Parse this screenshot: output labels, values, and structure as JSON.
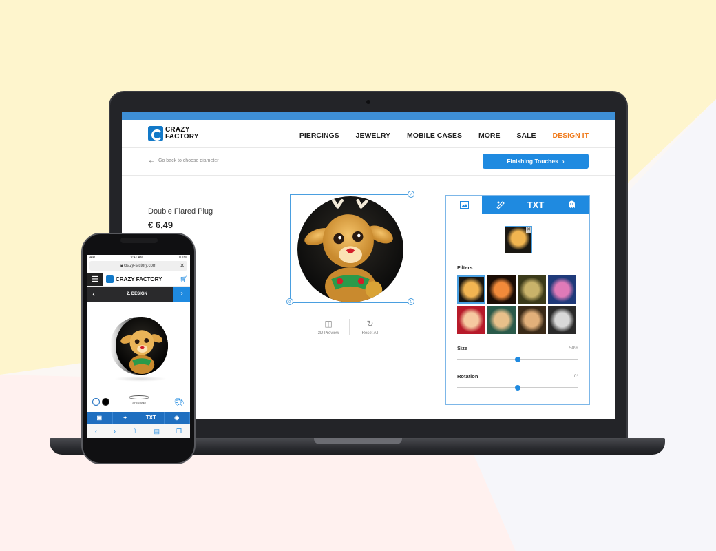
{
  "brand": {
    "line1": "CRAZY",
    "line2": "FACTORY",
    "mobile_logo": "CRAZY FACTORY"
  },
  "nav": {
    "items": [
      {
        "label": "PIERCINGS",
        "active": false
      },
      {
        "label": "JEWELRY",
        "active": false
      },
      {
        "label": "MOBILE CASES",
        "active": false
      },
      {
        "label": "MORE",
        "active": false
      },
      {
        "label": "SALE",
        "active": false
      },
      {
        "label": "DESIGN IT",
        "active": true
      }
    ]
  },
  "subheader": {
    "back_label": "Go back to choose diameter",
    "finish_label": "Finishing Touches"
  },
  "product": {
    "name": "Double Flared Plug",
    "price": "€ 6,49"
  },
  "tools": {
    "preview_label": "3D Preview",
    "reset_label": "Reset All"
  },
  "panel": {
    "tabs": [
      {
        "name": "image-icon",
        "label": "",
        "selected": true
      },
      {
        "name": "sticker-icon",
        "label": "",
        "selected": false
      },
      {
        "name": "text",
        "label": "TXT",
        "selected": false
      },
      {
        "name": "ghost-icon",
        "label": "",
        "selected": false
      }
    ],
    "filters_label": "Filters",
    "size_label": "Size",
    "size_value": "50%",
    "size_fraction": 0.5,
    "rotation_label": "Rotation",
    "rotation_value": "0°",
    "rotation_fraction": 0.5
  },
  "mobile": {
    "time": "9:41 AM",
    "battery": "100%",
    "carrier": "AIR",
    "url": "crazy-factory.com",
    "step_label": "2. DESIGN",
    "spin_label": "SPIN ME!",
    "tab_text": "TXT"
  },
  "colors": {
    "accent": "#1f8ae0",
    "nav_active": "#f07c1e",
    "top_bar": "#3e8fd6"
  }
}
